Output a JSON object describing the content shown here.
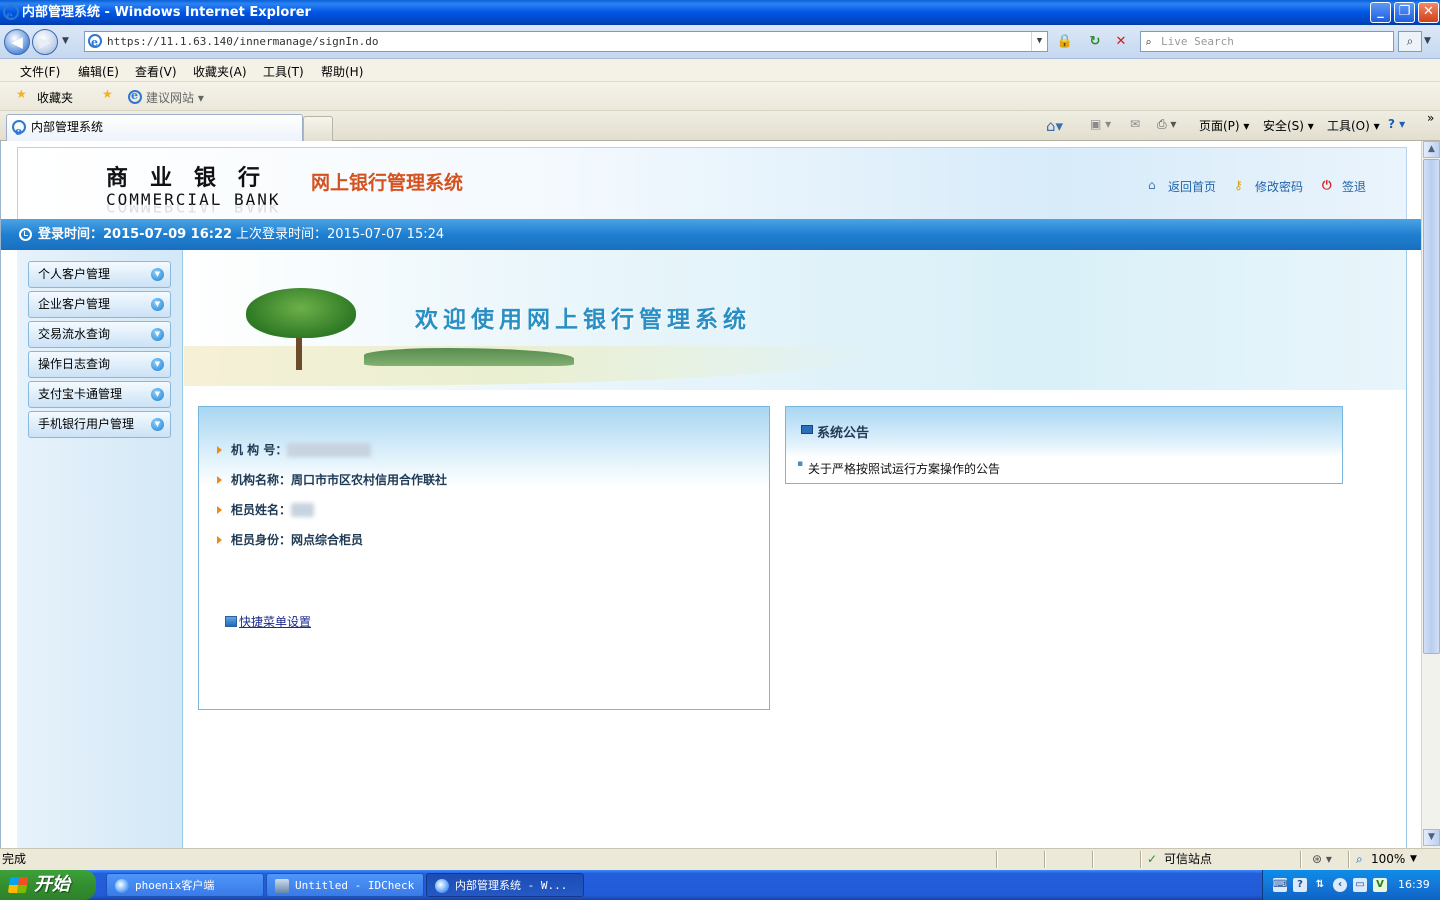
{
  "window": {
    "title": "内部管理系统 - Windows Internet Explorer",
    "minimize": "_",
    "maximize": "❐",
    "close": "✕"
  },
  "address_bar": {
    "url": "https://11.1.63.140/innermanage/signIn.do",
    "search_placeholder": "Live Search"
  },
  "menu": [
    "文件(F)",
    "编辑(E)",
    "查看(V)",
    "收藏夹(A)",
    "工具(T)",
    "帮助(H)"
  ],
  "favorites": {
    "label": "收藏夹",
    "suggested": "建议网站 ▾"
  },
  "tab": {
    "title": "内部管理系统"
  },
  "command_bar": {
    "page": "页面(P) ▾",
    "safety": "安全(S) ▾",
    "tools": "工具(O) ▾",
    "help": "? ▾",
    "more": "»"
  },
  "bank": {
    "name_cn": "商业银行",
    "name_en": "COMMERCIAL BANK",
    "system_name": "网上银行管理系统",
    "links": {
      "home": "返回首页",
      "change_password": "修改密码",
      "logout": "签退"
    }
  },
  "login": {
    "current": "登录时间：2015-07-09 16:22",
    "last": "上次登录时间：2015-07-07 15:24"
  },
  "sidebar": {
    "items": [
      {
        "label": "个人客户管理"
      },
      {
        "label": "企业客户管理"
      },
      {
        "label": "交易流水查询"
      },
      {
        "label": "操作日志查询"
      },
      {
        "label": "支付宝卡通管理"
      },
      {
        "label": "手机银行用户管理"
      }
    ]
  },
  "banner": {
    "welcome": "欢迎使用网上银行管理系统"
  },
  "info": {
    "org_no_label": "机 构 号：",
    "org_no_value": "1107000000",
    "org_name_label": "机构名称：",
    "org_name_value": "周口市市区农村信用合作联社",
    "teller_name_label": "柜员姓名：",
    "teller_name_value": "█ █",
    "teller_role_label": "柜员身份：",
    "teller_role_value": "网点综合柜员",
    "quick_menu": "快捷菜单设置"
  },
  "notice": {
    "title": "系统公告",
    "items": [
      "关于严格按照试运行方案操作的公告"
    ]
  },
  "status": {
    "text": "完成",
    "zone": "可信站点",
    "zoom": "100%"
  },
  "taskbar": {
    "start": "开始",
    "tasks": [
      "phoenix客户端",
      "Untitled - IDCheck",
      "内部管理系统 - W..."
    ],
    "clock": "16:39"
  }
}
